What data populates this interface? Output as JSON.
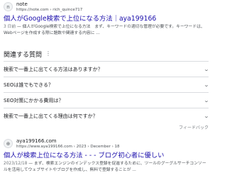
{
  "result1": {
    "favicon_icon": "n-letter-favicon",
    "site_name": "note",
    "url": "https://note.com › rich_quince717",
    "title": "個人がGoogle検索で上位になる方法｜aya199166",
    "date": "3 日前",
    "snippet": " — 個人がGoogle検索で上位になる方法　まず、キーワードの適切な管理が必要です。キーワードは、Webページを作成する際に題数や関連する内容に ..."
  },
  "paa": {
    "heading": "関連する質問",
    "more_icon": "vertical-dots-icon",
    "chevron_icon": "chevron-down-icon",
    "questions": [
      "検索で一番上に出てくる方法はありますか？",
      "SEOは誰でもできる？",
      "SEO対策にかかる費用は？",
      "検索で一番上に出てくる理由は何ですか？"
    ],
    "feedback": "フィードバック"
  },
  "result2": {
    "favicon_icon": "globe-favicon",
    "site_name": "aya199166.com",
    "url": "https://www.aya199166.com › 2023 › December › 18",
    "title": "個人が検索上位になる方法 - - - ブログ初心者に優しい",
    "date": "2023/12/18",
    "snippet": " — まず、検索エンジンのインデックス登録を促進するために、ツールのグーグルサーチコンソールを活用してウェブサイトやブログを作成し、無料で登録することが ..."
  }
}
